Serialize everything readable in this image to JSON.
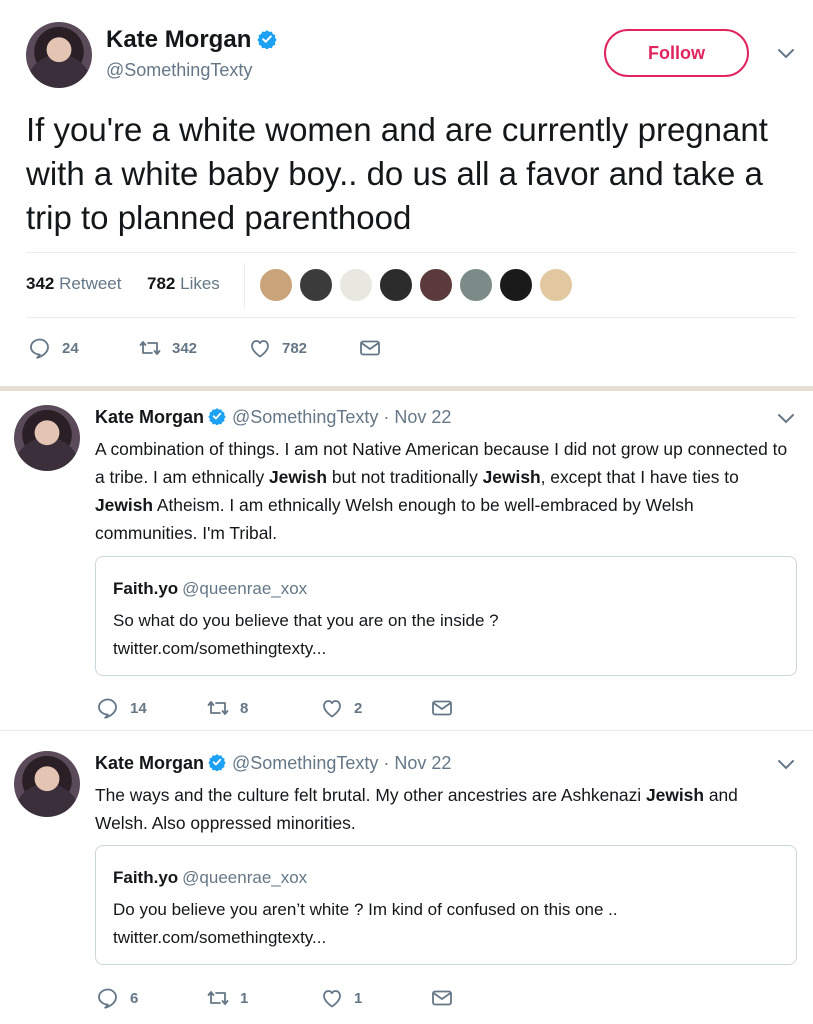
{
  "top_tweet": {
    "name": "Kate Morgan",
    "handle": "@SomethingTexty",
    "follow_label": "Follow",
    "text": "If you're a white women and are currently pregnant with a white baby boy.. do us all a favor and take a trip to planned parenthood",
    "retweets_count": "342",
    "retweets_label": "Retweet",
    "likes_count": "782",
    "likes_label": "Likes",
    "actions": {
      "reply": "24",
      "retweet": "342",
      "like": "782"
    }
  },
  "replies": [
    {
      "name": "Kate Morgan",
      "handle": "@SomethingTexty",
      "date": "· Nov 22",
      "text_parts": [
        "A combination of things. I am not Native American because I did not grow up connected to a tribe. I am ethnically ",
        "Jewish",
        " but not traditionally ",
        "Jewish",
        ", except that I have ties to ",
        "Jewish",
        " Atheism. I am ethnically Welsh enough to be well-embraced by Welsh communities. I'm Tribal."
      ],
      "quote": {
        "name": "Faith.yo",
        "handle": "@queenrae_xox",
        "text": "So what do you believe that you are on the inside ?",
        "link": "twitter.com/somethingtexty..."
      },
      "actions": {
        "reply": "14",
        "retweet": "8",
        "like": "2"
      }
    },
    {
      "name": "Kate Morgan",
      "handle": "@SomethingTexty",
      "date": "· Nov 22",
      "text_parts": [
        "The ways and the culture felt brutal. My other ancestries are Ashkenazi ",
        "Jewish",
        " and Welsh. Also oppressed minorities."
      ],
      "quote": {
        "name": "Faith.yo",
        "handle": "@queenrae_xox",
        "text": "Do you believe you aren’t white ? Im kind of confused on this one ..",
        "link": "twitter.com/somethingtexty..."
      },
      "actions": {
        "reply": "6",
        "retweet": "1",
        "like": "1"
      }
    }
  ],
  "icons": {
    "verified": "verified-badge-icon",
    "reply": "reply-icon",
    "retweet": "retweet-icon",
    "like": "heart-icon",
    "message": "envelope-icon",
    "caret": "chevron-down-icon"
  },
  "colors": {
    "verified": "#1da1f2",
    "follow": "#e0245e",
    "muted": "#657786",
    "text": "#14171a"
  }
}
